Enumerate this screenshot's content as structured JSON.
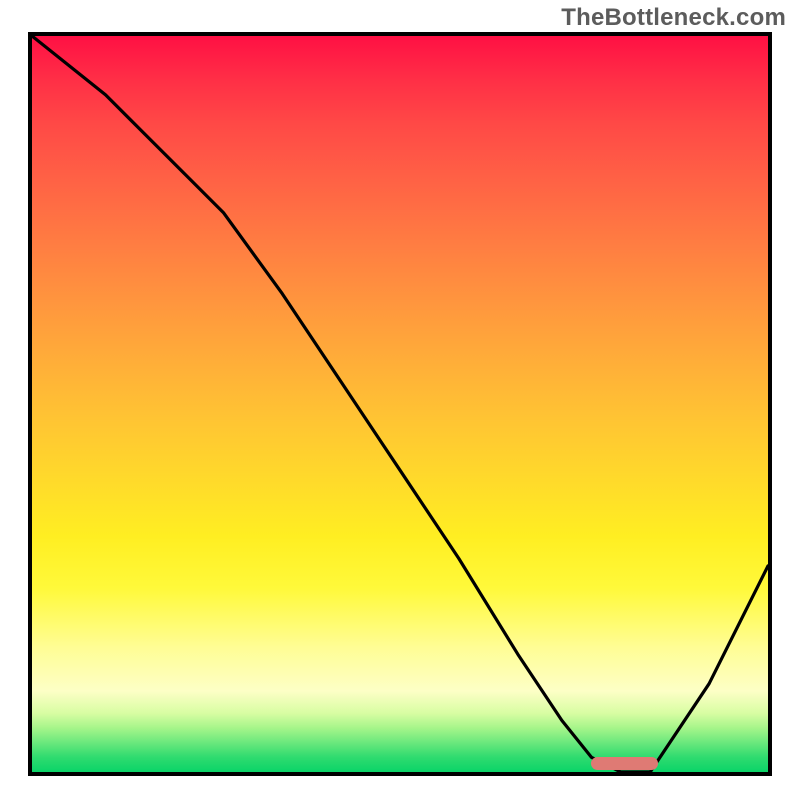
{
  "watermark": "TheBottleneck.com",
  "colors": {
    "border": "#000000",
    "curve": "#000000",
    "marker": "#df7a74",
    "gradient_top": "#ff1044",
    "gradient_mid": "#ffee22",
    "gradient_bottom": "#0ad468"
  },
  "chart_data": {
    "type": "line",
    "title": "",
    "xlabel": "",
    "ylabel": "",
    "xlim": [
      0,
      100
    ],
    "ylim": [
      0,
      100
    ],
    "grid": false,
    "series": [
      {
        "name": "bottleneck-curve",
        "x": [
          0,
          10,
          18,
          26,
          34,
          42,
          50,
          58,
          66,
          72,
          76,
          80,
          84,
          92,
          100
        ],
        "y": [
          100,
          92,
          84,
          76,
          65,
          53,
          41,
          29,
          16,
          7,
          2,
          0,
          0,
          12,
          28
        ]
      }
    ],
    "annotations": [
      {
        "name": "optimal-range-marker",
        "x_start": 76,
        "x_end": 85,
        "y": 0
      }
    ]
  }
}
